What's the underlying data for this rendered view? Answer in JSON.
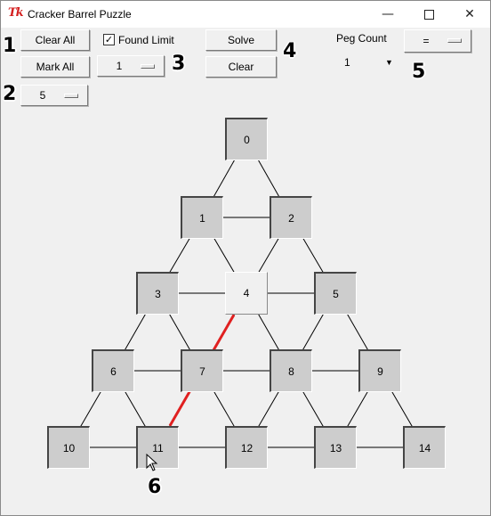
{
  "window": {
    "title": "Cracker Barrel Puzzle",
    "logo": "Tk"
  },
  "controls": {
    "clear_all": "Clear All",
    "mark_all": "Mark All",
    "found_limit_label": "Found Limit",
    "found_limit_checked": true,
    "limit_value": "1",
    "board_size": "5",
    "solve": "Solve",
    "clear": "Clear",
    "peg_count_label": "Peg Count",
    "peg_count_value": "1",
    "compare_op": "="
  },
  "callouts": [
    "1",
    "2",
    "3",
    "4",
    "5",
    "6"
  ],
  "pegs": [
    {
      "label": "0",
      "filled": true
    },
    {
      "label": "1",
      "filled": true
    },
    {
      "label": "2",
      "filled": true
    },
    {
      "label": "3",
      "filled": true
    },
    {
      "label": "4",
      "filled": false
    },
    {
      "label": "5",
      "filled": true
    },
    {
      "label": "6",
      "filled": true
    },
    {
      "label": "7",
      "filled": true
    },
    {
      "label": "8",
      "filled": true
    },
    {
      "label": "9",
      "filled": true
    },
    {
      "label": "10",
      "filled": true
    },
    {
      "label": "11",
      "filled": true
    },
    {
      "label": "12",
      "filled": true
    },
    {
      "label": "13",
      "filled": true
    },
    {
      "label": "14",
      "filled": true
    }
  ],
  "highlighted_move": {
    "from": "11",
    "over": "7",
    "to": "4",
    "color": "#e02020"
  },
  "icons": [
    "tk-logo-icon",
    "minimize-icon",
    "maximize-icon",
    "close-icon",
    "checkmark-icon",
    "dropdown-arrow-icon",
    "mouse-cursor-icon"
  ]
}
